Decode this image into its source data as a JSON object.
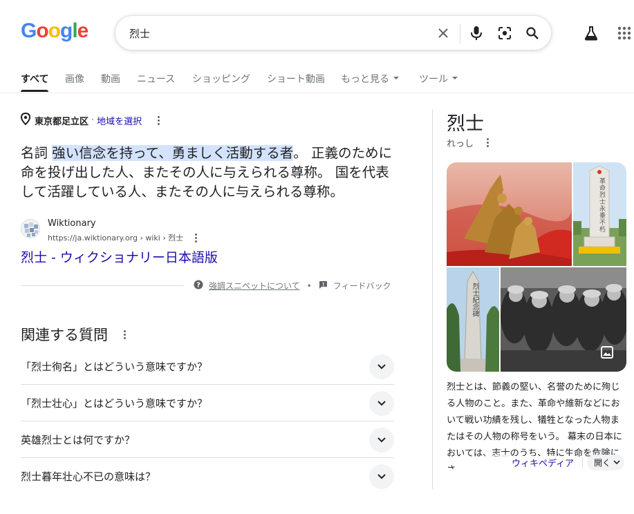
{
  "header": {
    "logo_letters": [
      "G",
      "o",
      "o",
      "g",
      "l",
      "e"
    ],
    "logo_colors": [
      "#4285f4",
      "#ea4335",
      "#fbbc05",
      "#4285f4",
      "#34a853",
      "#ea4335"
    ],
    "search_value": "烈士"
  },
  "tabs": [
    {
      "label": "すべて",
      "active": true
    },
    {
      "label": "画像"
    },
    {
      "label": "動画"
    },
    {
      "label": "ニュース"
    },
    {
      "label": "ショッピング"
    },
    {
      "label": "ショート動画"
    },
    {
      "label": "もっと見る"
    },
    {
      "label": "ツール"
    }
  ],
  "location": {
    "name": "東京都足立区",
    "separator": "·",
    "link": "地域を選択"
  },
  "definition": {
    "pos": "名詞",
    "highlight": "強い信念を持って、勇ましく活動する者",
    "rest": "。 正義のために命を投げ出した人、またその人に与えられる尊称。 国を代表して活躍している人、またその人に与えられる尊称。"
  },
  "source": {
    "name": "Wiktionary",
    "url": "https://ja.wiktionary.org › wiki › 烈士",
    "title": "烈士 - ウィクショナリー日本語版"
  },
  "feedback": {
    "about": "強調スニペットについて",
    "dot": "•",
    "feedback": "フィードバック"
  },
  "related": {
    "title": "関連する質問",
    "questions": [
      "「烈士徇名」とはどういう意味ですか？",
      "「烈士壮心」とはどういう意味ですか？",
      "英雄烈士とは何ですか？",
      "烈士暮年壮心不已の意味は？"
    ]
  },
  "knowledge_panel": {
    "title": "烈士",
    "reading": "れっし",
    "description": "烈士とは、節義の堅い、名誉のために殉じる人物のこと。また、革命や維新などにおいて戦い功績を残し、犠牲となった人物またはその人物の称号をいう。 幕末の日本においては、志士のうち、特に生命を危険にさ",
    "wiki_link": "ウィキペディア",
    "open_label": "開く",
    "monument_text": "革命烈士永垂不朽",
    "obelisk_text": "烈士紀念碑"
  },
  "colors": {
    "link": "#1a0dab",
    "highlight": "#d3e3fd",
    "muted": "#70757a"
  }
}
